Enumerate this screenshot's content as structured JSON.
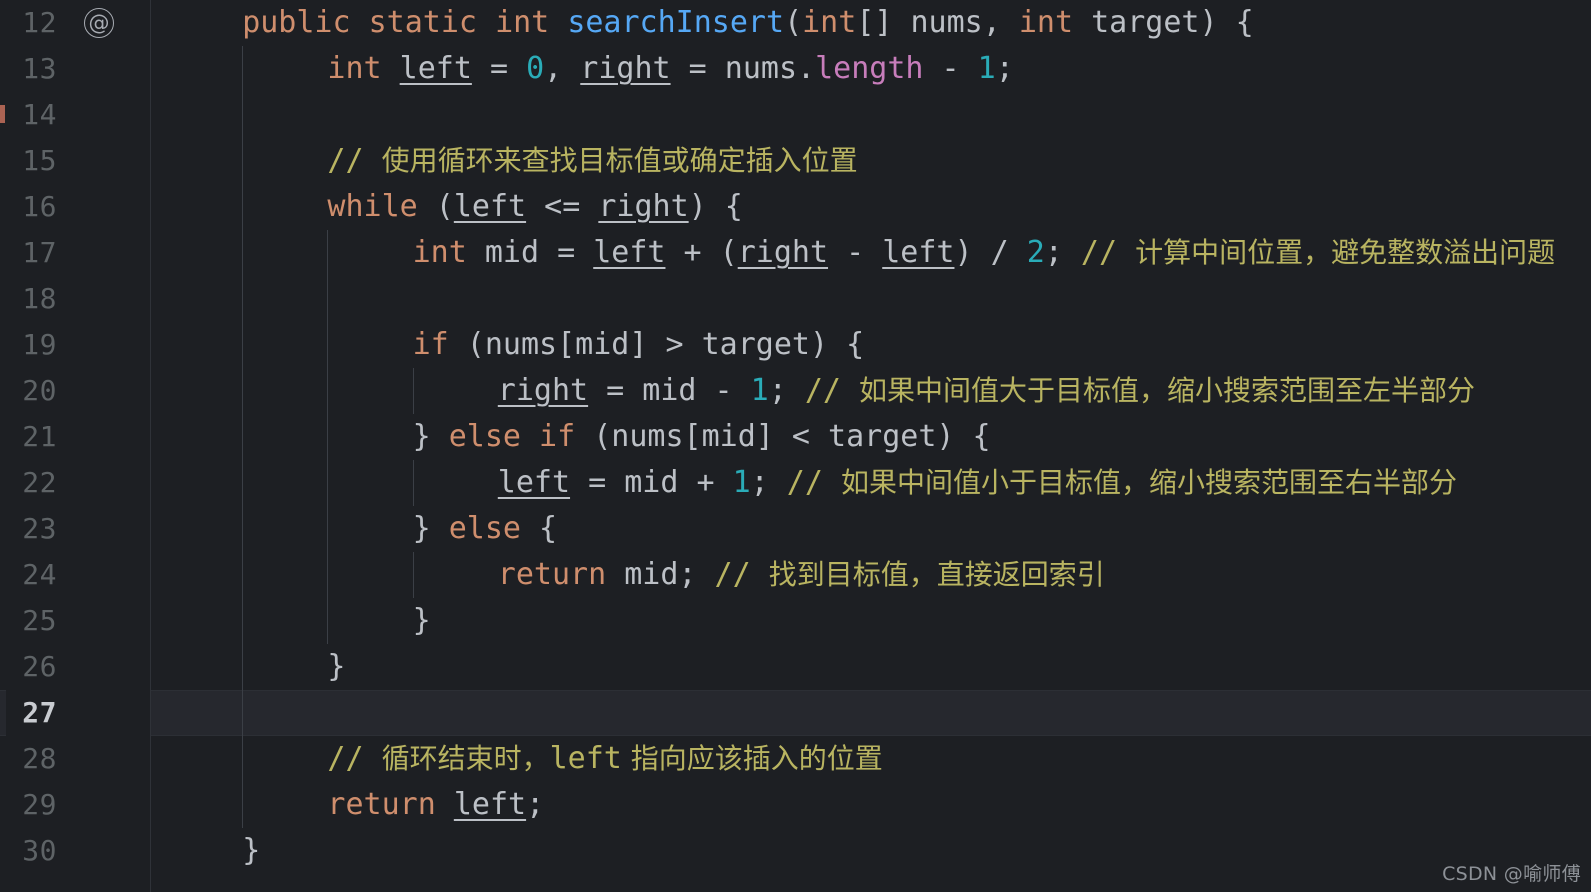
{
  "editor": {
    "language": "java",
    "theme": "dark",
    "background_color": "#1d1f23",
    "current_line_color": "#26282e",
    "first_visible_line": 12,
    "last_visible_line": 30,
    "current_line": 27,
    "gutter_icon": "@",
    "gutter_icon_name": "override-annotation-icon",
    "line_numbers": [
      "12",
      "13",
      "14",
      "15",
      "16",
      "17",
      "18",
      "19",
      "20",
      "21",
      "22",
      "23",
      "24",
      "25",
      "26",
      "27",
      "28",
      "29",
      "30"
    ],
    "colors": {
      "keyword": "#cf8e6d",
      "method": "#56a8f5",
      "number": "#2aacb8",
      "field": "#c77dbb",
      "comment": "#b9b461",
      "identifier": "#bcc0c6",
      "line_number": "#5e6366",
      "line_number_active": "#c9ccd1"
    },
    "lines": [
      {
        "n": "12",
        "indent": 1,
        "tokens": [
          {
            "t": "public",
            "c": "kw"
          },
          {
            "t": " ",
            "c": "plain"
          },
          {
            "t": "static",
            "c": "kw"
          },
          {
            "t": " ",
            "c": "plain"
          },
          {
            "t": "int",
            "c": "kw"
          },
          {
            "t": " ",
            "c": "plain"
          },
          {
            "t": "searchInsert",
            "c": "fn"
          },
          {
            "t": "(",
            "c": "plain"
          },
          {
            "t": "int",
            "c": "kw"
          },
          {
            "t": "[] nums, ",
            "c": "plain"
          },
          {
            "t": "int",
            "c": "kw"
          },
          {
            "t": " target) {",
            "c": "plain"
          }
        ]
      },
      {
        "n": "13",
        "indent": 2,
        "tokens": [
          {
            "t": "int",
            "c": "kw"
          },
          {
            "t": " ",
            "c": "plain"
          },
          {
            "t": "left",
            "c": "var"
          },
          {
            "t": " = ",
            "c": "plain"
          },
          {
            "t": "0",
            "c": "num"
          },
          {
            "t": ", ",
            "c": "plain"
          },
          {
            "t": "right",
            "c": "var"
          },
          {
            "t": " = nums.",
            "c": "plain"
          },
          {
            "t": "length",
            "c": "fld"
          },
          {
            "t": " - ",
            "c": "plain"
          },
          {
            "t": "1",
            "c": "num"
          },
          {
            "t": ";",
            "c": "plain"
          }
        ]
      },
      {
        "n": "14",
        "indent": 0,
        "tokens": []
      },
      {
        "n": "15",
        "indent": 2,
        "tokens": [
          {
            "t": "// ",
            "c": "cmt"
          },
          {
            "t": "使用循环来查找目标值或确定插入位置",
            "c": "cmt-cn"
          }
        ]
      },
      {
        "n": "16",
        "indent": 2,
        "tokens": [
          {
            "t": "while",
            "c": "kw"
          },
          {
            "t": " (",
            "c": "plain"
          },
          {
            "t": "left",
            "c": "var"
          },
          {
            "t": " <= ",
            "c": "plain"
          },
          {
            "t": "right",
            "c": "var"
          },
          {
            "t": ") {",
            "c": "plain"
          }
        ]
      },
      {
        "n": "17",
        "indent": 3,
        "tokens": [
          {
            "t": "int",
            "c": "kw"
          },
          {
            "t": " mid = ",
            "c": "plain"
          },
          {
            "t": "left",
            "c": "var"
          },
          {
            "t": " + (",
            "c": "plain"
          },
          {
            "t": "right",
            "c": "var"
          },
          {
            "t": " - ",
            "c": "plain"
          },
          {
            "t": "left",
            "c": "var"
          },
          {
            "t": ") / ",
            "c": "plain"
          },
          {
            "t": "2",
            "c": "num"
          },
          {
            "t": "; ",
            "c": "plain"
          },
          {
            "t": "// ",
            "c": "cmt"
          },
          {
            "t": "计算中间位置，避免整数溢出问题",
            "c": "cmt-cn"
          }
        ]
      },
      {
        "n": "18",
        "indent": 0,
        "tokens": []
      },
      {
        "n": "19",
        "indent": 3,
        "tokens": [
          {
            "t": "if",
            "c": "kw"
          },
          {
            "t": " (nums[mid] > target) {",
            "c": "plain"
          }
        ]
      },
      {
        "n": "20",
        "indent": 4,
        "tokens": [
          {
            "t": "right",
            "c": "var"
          },
          {
            "t": " = mid - ",
            "c": "plain"
          },
          {
            "t": "1",
            "c": "num"
          },
          {
            "t": "; ",
            "c": "plain"
          },
          {
            "t": "// ",
            "c": "cmt"
          },
          {
            "t": "如果中间值大于目标值，缩小搜索范围至左半部分",
            "c": "cmt-cn"
          }
        ]
      },
      {
        "n": "21",
        "indent": 3,
        "tokens": [
          {
            "t": "} ",
            "c": "plain"
          },
          {
            "t": "else",
            "c": "kw"
          },
          {
            "t": " ",
            "c": "plain"
          },
          {
            "t": "if",
            "c": "kw"
          },
          {
            "t": " (nums[mid] < target) {",
            "c": "plain"
          }
        ]
      },
      {
        "n": "22",
        "indent": 4,
        "tokens": [
          {
            "t": "left",
            "c": "var"
          },
          {
            "t": " = mid + ",
            "c": "plain"
          },
          {
            "t": "1",
            "c": "num"
          },
          {
            "t": "; ",
            "c": "plain"
          },
          {
            "t": "// ",
            "c": "cmt"
          },
          {
            "t": "如果中间值小于目标值，缩小搜索范围至右半部分",
            "c": "cmt-cn"
          }
        ]
      },
      {
        "n": "23",
        "indent": 3,
        "tokens": [
          {
            "t": "} ",
            "c": "plain"
          },
          {
            "t": "else",
            "c": "kw"
          },
          {
            "t": " {",
            "c": "plain"
          }
        ]
      },
      {
        "n": "24",
        "indent": 4,
        "tokens": [
          {
            "t": "return",
            "c": "kw"
          },
          {
            "t": " mid; ",
            "c": "plain"
          },
          {
            "t": "// ",
            "c": "cmt"
          },
          {
            "t": "找到目标值，直接返回索引",
            "c": "cmt-cn"
          }
        ]
      },
      {
        "n": "25",
        "indent": 3,
        "tokens": [
          {
            "t": "}",
            "c": "plain"
          }
        ]
      },
      {
        "n": "26",
        "indent": 2,
        "tokens": [
          {
            "t": "}",
            "c": "plain"
          }
        ]
      },
      {
        "n": "27",
        "indent": 0,
        "tokens": []
      },
      {
        "n": "28",
        "indent": 2,
        "tokens": [
          {
            "t": "// ",
            "c": "cmt"
          },
          {
            "t": "循环结束时，",
            "c": "cmt-cn"
          },
          {
            "t": "left",
            "c": "cmt"
          },
          {
            "t": " 指向应该插入的位置",
            "c": "cmt-cn"
          }
        ]
      },
      {
        "n": "29",
        "indent": 2,
        "tokens": [
          {
            "t": "return",
            "c": "kw"
          },
          {
            "t": " ",
            "c": "plain"
          },
          {
            "t": "left",
            "c": "var"
          },
          {
            "t": ";",
            "c": "plain"
          }
        ]
      },
      {
        "n": "30",
        "indent": 1,
        "tokens": [
          {
            "t": "}",
            "c": "plain"
          }
        ]
      }
    ],
    "indent_guides": [
      {
        "level": 1,
        "from_line": "13",
        "to_line": "29"
      },
      {
        "level": 2,
        "from_line": "17",
        "to_line": "25"
      },
      {
        "level": 3,
        "from_line": "20",
        "to_line": "20"
      },
      {
        "level": 3,
        "from_line": "22",
        "to_line": "22"
      },
      {
        "level": 3,
        "from_line": "24",
        "to_line": "24"
      }
    ]
  },
  "watermark": {
    "text": "CSDN @喻师傅"
  }
}
